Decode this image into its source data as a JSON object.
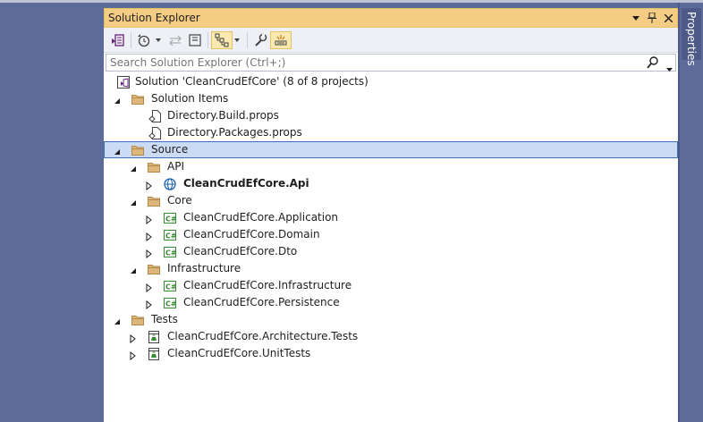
{
  "panel": {
    "title": "Solution Explorer",
    "search_placeholder": "Search Solution Explorer (Ctrl+;)"
  },
  "side_tab": {
    "label": "Properties"
  },
  "tree": [
    {
      "text": "Solution 'CleanCrudEfCore' (8 of 8 projects)",
      "icon": "solution-icon",
      "bold": false
    },
    {
      "text": "Solution Items",
      "icon": "folder-icon",
      "bold": false
    },
    {
      "text": "Directory.Build.props",
      "icon": "file-icon",
      "bold": false
    },
    {
      "text": "Directory.Packages.props",
      "icon": "file-icon",
      "bold": false
    },
    {
      "text": "Source",
      "icon": "folder-icon",
      "bold": false,
      "selected": true
    },
    {
      "text": "API",
      "icon": "folder-icon",
      "bold": false
    },
    {
      "text": "CleanCrudEfCore.Api",
      "icon": "web-project-icon",
      "bold": true
    },
    {
      "text": "Core",
      "icon": "folder-icon",
      "bold": false
    },
    {
      "text": "CleanCrudEfCore.Application",
      "icon": "csharp-project-icon",
      "bold": false
    },
    {
      "text": "CleanCrudEfCore.Domain",
      "icon": "csharp-project-icon",
      "bold": false
    },
    {
      "text": "CleanCrudEfCore.Dto",
      "icon": "csharp-project-icon",
      "bold": false
    },
    {
      "text": "Infrastructure",
      "icon": "folder-icon",
      "bold": false
    },
    {
      "text": "CleanCrudEfCore.Infrastructure",
      "icon": "csharp-project-icon",
      "bold": false
    },
    {
      "text": "CleanCrudEfCore.Persistence",
      "icon": "csharp-project-icon",
      "bold": false
    },
    {
      "text": "Tests",
      "icon": "folder-icon",
      "bold": false
    },
    {
      "text": "CleanCrudEfCore.Architecture.Tests",
      "icon": "test-project-icon",
      "bold": false
    },
    {
      "text": "CleanCrudEfCore.UnitTests",
      "icon": "test-project-icon",
      "bold": false
    }
  ],
  "colors": {
    "title_bar": "#f5cc84",
    "selection": "#ccdbf4",
    "background": "#5d6b99"
  }
}
